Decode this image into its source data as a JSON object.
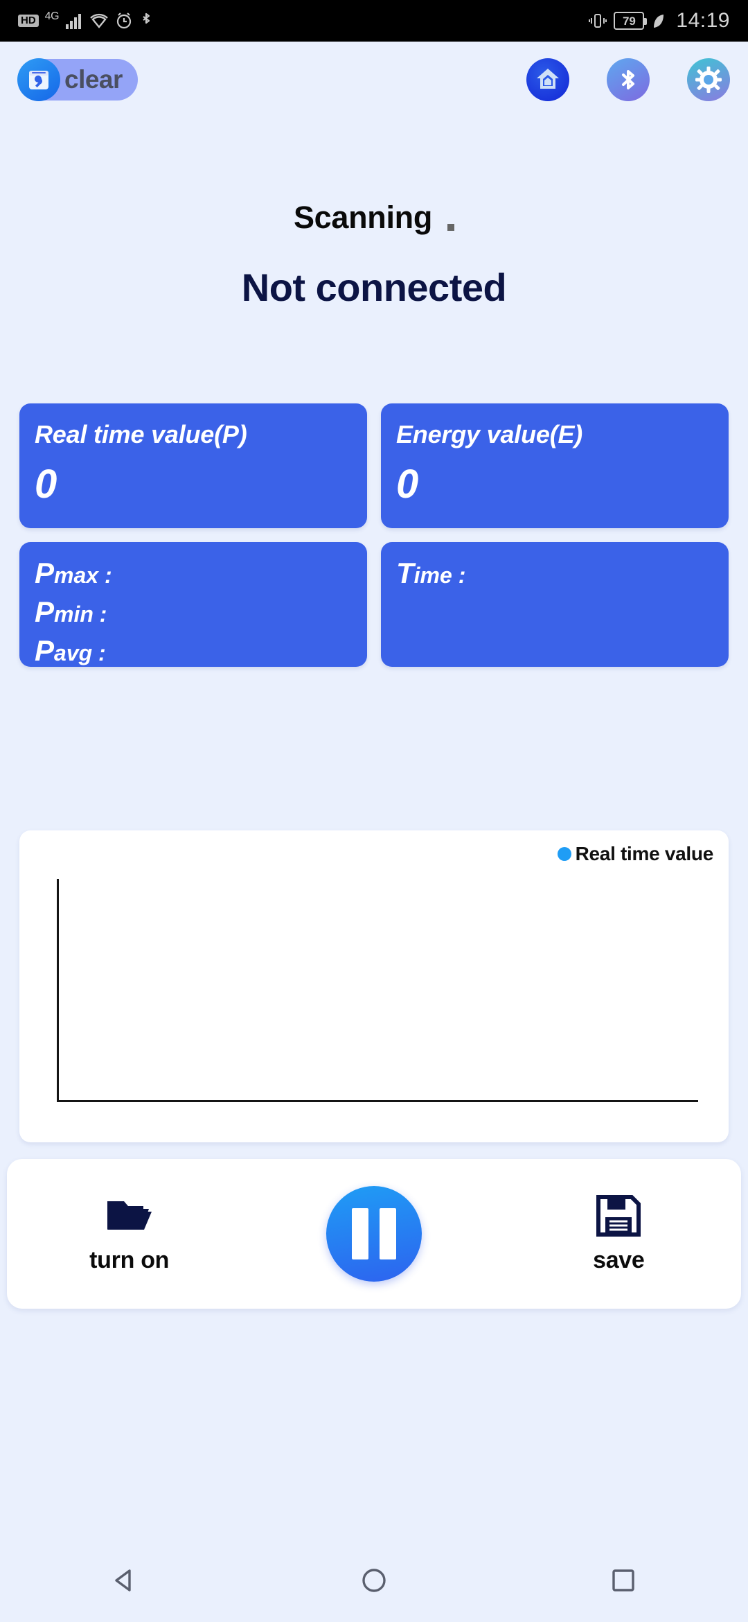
{
  "status_bar": {
    "hd_label": "HD",
    "network_label": "4G",
    "icons": [
      "hd-badge",
      "4g-signal-icon",
      "wifi-icon",
      "alarm-icon",
      "bluetooth-icon",
      "vibrate-icon",
      "battery-icon",
      "power-saving-leaf-icon"
    ],
    "battery_level": "79",
    "time": "14:19"
  },
  "appbar": {
    "clear_label": "clear",
    "clear_icon": "calendar-wrench-icon",
    "actions": [
      {
        "name": "home-icon",
        "label": "home"
      },
      {
        "name": "bluetooth-icon",
        "label": "bluetooth"
      },
      {
        "name": "gear-icon",
        "label": "settings"
      }
    ]
  },
  "status": {
    "scanning_label": "Scanning",
    "scanning_dot": ".",
    "connection_label": "Not connected"
  },
  "cards": {
    "realtime": {
      "title": "Real time value(P)",
      "value": "0"
    },
    "energy": {
      "title": "Energy value(E)",
      "value": "0"
    },
    "stats": {
      "pmax_big": "P",
      "pmax_small": "max :",
      "pmin_big": "P",
      "pmin_small": "min :",
      "pavg_big": "P",
      "pavg_small": "avg :"
    },
    "time_card": {
      "big": "T",
      "small": "ime :"
    }
  },
  "chart_data": {
    "type": "line",
    "title": "",
    "legend": [
      "Real time value"
    ],
    "legend_position": "top-right",
    "legend_color": "#1f9df5",
    "series": [
      {
        "name": "Real time value",
        "x": [],
        "values": []
      }
    ],
    "xlabel": "",
    "ylabel": "",
    "xticks": [],
    "yticks": [],
    "grid": false,
    "note": "empty plot, only x and y axis lines drawn"
  },
  "controls": {
    "turn_on": {
      "label": "turn on",
      "icon": "open-folder-icon"
    },
    "play_pause": {
      "label": "pause",
      "icon": "pause-icon"
    },
    "save": {
      "label": "save",
      "icon": "floppy-disk-icon"
    }
  },
  "navbar": {
    "back": "back-triangle-icon",
    "home": "home-circle-icon",
    "recents": "recents-square-icon"
  },
  "colors": {
    "page_background": "#eaf0fd",
    "card_blue": "#3b62e8",
    "accent_blue": "#1f9df5",
    "heading_navy": "#0c1444",
    "panel_white": "#ffffff"
  }
}
